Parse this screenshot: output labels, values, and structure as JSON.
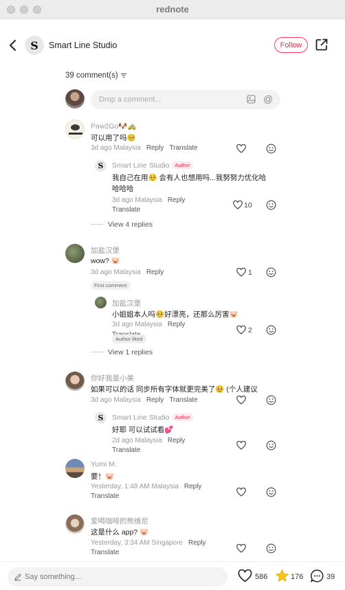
{
  "window": {
    "title": "rednote"
  },
  "header": {
    "author_name": "Smart Line Studio",
    "follow_label": "Follow"
  },
  "comments_count": "39 comment(s)",
  "input": {
    "placeholder": "Drop a comment..."
  },
  "comments": [
    {
      "name": "Paw2Go🐶🚕",
      "text": "可以用了吗🥺",
      "meta": "3d ago Malaysia",
      "reply": "Reply",
      "translate": "Translate",
      "replies": [
        {
          "name": "Smart Line Studio",
          "tag": "Author",
          "text1": "我自己在用🥺 会有人也想用吗...我努努力优化哈",
          "text2": "哈哈哈",
          "meta": "3d ago Malaysia",
          "reply": "Reply",
          "translate": "Translate",
          "likes": "10"
        }
      ],
      "view_more": "View 4 replies"
    },
    {
      "name": "加盐汉堡",
      "text": "wow? 🐷",
      "meta": "3d ago Malaysia",
      "reply": "Reply",
      "likes": "1",
      "badge": "First comment",
      "replies": [
        {
          "name": "加盐汉堡",
          "text1": "小姐姐本人吗🥺好漂亮，还那么厉害🐷",
          "meta": "3d ago Malaysia",
          "reply": "Reply",
          "translate": "Translate",
          "badge": "Author liked",
          "likes": "2"
        }
      ],
      "view_more": "View 1 replies"
    },
    {
      "name": "你好我是小美",
      "text": "如果可以的话 同步所有字体就更完美了🥹 (个人建议",
      "meta": "3d ago Malaysia",
      "reply": "Reply",
      "translate": "Translate",
      "replies": [
        {
          "name": "Smart Line Studio",
          "tag": "Author",
          "text1": "好耶 可以试试看💕",
          "meta": "2d ago Malaysia",
          "reply": "Reply",
          "translate": "Translate"
        }
      ]
    },
    {
      "name": "Yumi M.",
      "text": "要！🐷",
      "meta": "Yesterday, 1:48 AM Malaysia",
      "reply": "Reply",
      "translate": "Translate"
    },
    {
      "name": "爱喝咖啡的熊维尼",
      "text": "这是什么 app? 🐷",
      "meta": "Yesterday, 3:34 AM Singapore",
      "reply": "Reply",
      "translate": "Translate"
    }
  ],
  "bottom": {
    "placeholder": "Say something...",
    "likes": "586",
    "stars": "176",
    "comments": "39"
  },
  "colors": {
    "accent": "#ff2442",
    "star": "#f5c518"
  }
}
